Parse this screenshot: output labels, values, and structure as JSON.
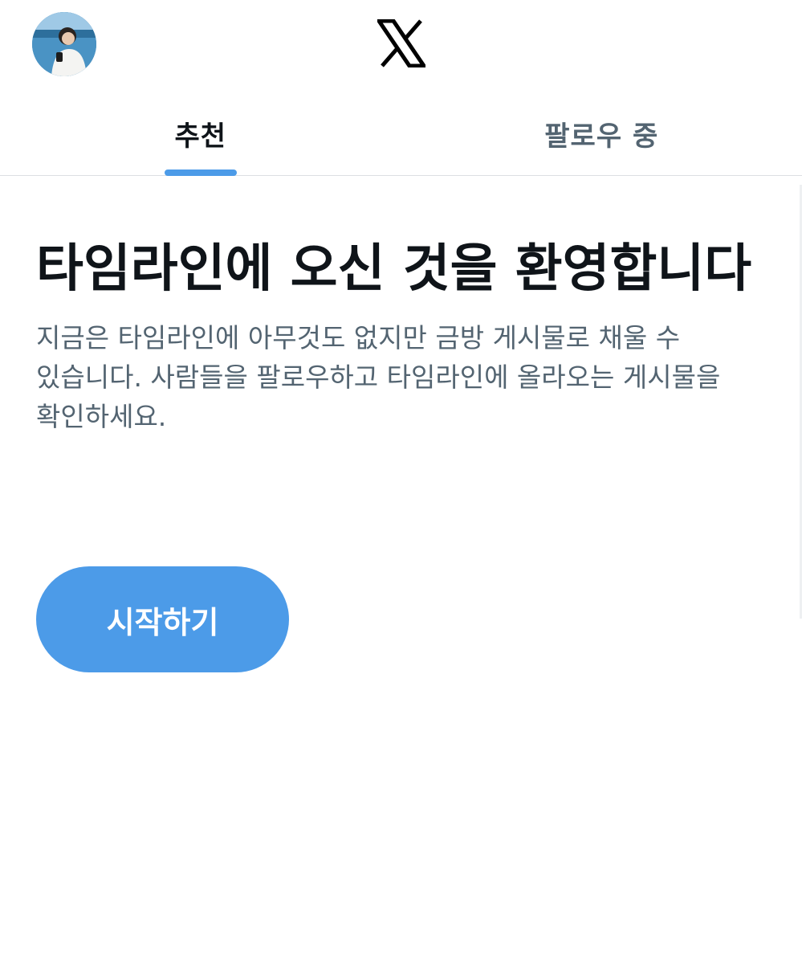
{
  "header": {
    "avatar_icon": "user-avatar",
    "logo_icon": "x-logo-icon"
  },
  "tabs": [
    {
      "label": "추천",
      "active": true
    },
    {
      "label": "팔로우 중",
      "active": false
    }
  ],
  "main": {
    "title": "타임라인에 오신 것을 환영합니다",
    "description": "지금은 타임라인에 아무것도 없지만 금방 게시물로 채울 수 있습니다. 사람들을 팔로우하고 타임라인에 올라오는 게시물을 확인하세요.",
    "start_button_label": "시작하기"
  },
  "colors": {
    "accent": "#4c9be8",
    "text_primary": "#0f1419",
    "text_secondary": "#536471",
    "divider": "#dcdfe3"
  }
}
